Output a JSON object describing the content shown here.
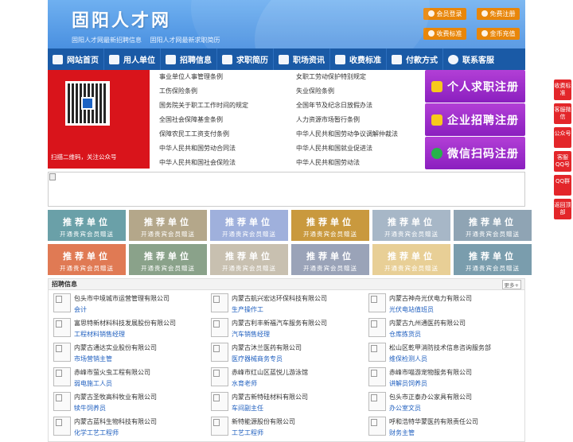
{
  "header": {
    "title": "固阳人才网",
    "sub_links": [
      "固阳人才网最新招聘信息",
      "固阳人才网最新求职简历"
    ],
    "buttons": {
      "member_login": "会员登录",
      "free_register": "免费注册",
      "fee_standard": "收费标准",
      "coin_recharge": "金币充值"
    }
  },
  "nav": [
    {
      "label": "网站首页",
      "icon": "home-icon"
    },
    {
      "label": "用人单位",
      "icon": "building-icon"
    },
    {
      "label": "招聘信息",
      "icon": "megaphone-icon"
    },
    {
      "label": "求职简历",
      "icon": "resume-icon"
    },
    {
      "label": "职场资讯",
      "icon": "news-icon"
    },
    {
      "label": "收费标准",
      "icon": "yen-icon"
    },
    {
      "label": "付款方式",
      "icon": "card-icon"
    },
    {
      "label": "联系客服",
      "icon": "phone-icon"
    }
  ],
  "qr": {
    "caption": "扫描二维码，关注公众号"
  },
  "laws": [
    "事业单位人事管理条例",
    "女职工劳动保护特别规定",
    "工伤保险条例",
    "失业保险条例",
    "国务院关于职工工作时间的规定",
    "全国年节及纪念日放假办法",
    "全国社会保障基金条例",
    "人力资源市场暂行条例",
    "保障农民工工资支付条例",
    "中华人民共和国劳动争议调解仲裁法",
    "中华人民共和国劳动合同法",
    "中华人民共和国就业促进法",
    "中华人民共和国社会保险法",
    "中华人民共和国劳动法"
  ],
  "register": [
    "个人求职注册",
    "企业招聘注册",
    "微信扫码注册"
  ],
  "ads": {
    "title": "推荐单位",
    "subtitle": "开通贵宾会员赠送",
    "colors": [
      "#6aa0a8",
      "#b4a78a",
      "#9fb0dc",
      "#c9993e",
      "#a7b7c7",
      "#8fa4b4",
      "#e07a54",
      "#8aa28a",
      "#c8c0b0",
      "#9aa3b8",
      "#e8cf96",
      "#7a9dad"
    ]
  },
  "jobs": {
    "title": "招聘信息",
    "more": "更多+",
    "items": [
      {
        "company": "包头市中境城市运营管理有限公司",
        "position": "会计"
      },
      {
        "company": "内蒙古航兴宏达环保科技有限公司",
        "position": "生产操作工"
      },
      {
        "company": "内蒙古神舟光伏电力有限公司",
        "position": "光伏电站值班员"
      },
      {
        "company": "富思特新材料科技发展股份有限公司",
        "position": "工程材料销售经理"
      },
      {
        "company": "内蒙古利丰新福汽车服务有限公司",
        "position": "汽车销售经理"
      },
      {
        "company": "内蒙古九州通医药有限公司",
        "position": "仓库拣货员"
      },
      {
        "company": "内蒙古通达实业股份有限公司",
        "position": "市场营销主管"
      },
      {
        "company": "内蒙古沐兰医药有限公司",
        "position": "医疗器械商务专员"
      },
      {
        "company": "松山区乾甲消防技术信息咨询服务部",
        "position": "维保检测人员"
      },
      {
        "company": "赤峰市萤火虫工程有限公司",
        "position": "弱电施工人员"
      },
      {
        "company": "赤峰市红山区蓝悦儿游泳馆",
        "position": "水育老师"
      },
      {
        "company": "赤峰市喵游宠物服务有限公司",
        "position": "讲解员饲养员"
      },
      {
        "company": "内蒙古圣牧高科牧业有限公司",
        "position": "犊牛饲养员"
      },
      {
        "company": "内蒙古新特硅材料有限公司",
        "position": "车间副主任"
      },
      {
        "company": "包头市正泰办公家具有限公司",
        "position": "办公室文员"
      },
      {
        "company": "内蒙古蓝科生物科技有限公司",
        "position": "化学工艺工程师"
      },
      {
        "company": "新特能源股份有限公司",
        "position": "工艺工程师"
      },
      {
        "company": "呼和浩特华蒙医药有限责任公司",
        "position": "财务主管"
      }
    ]
  },
  "sidefloat": [
    "收费标准",
    "客服微信",
    "公众号",
    "客服QQ号",
    "QQ群",
    "返回顶部"
  ]
}
